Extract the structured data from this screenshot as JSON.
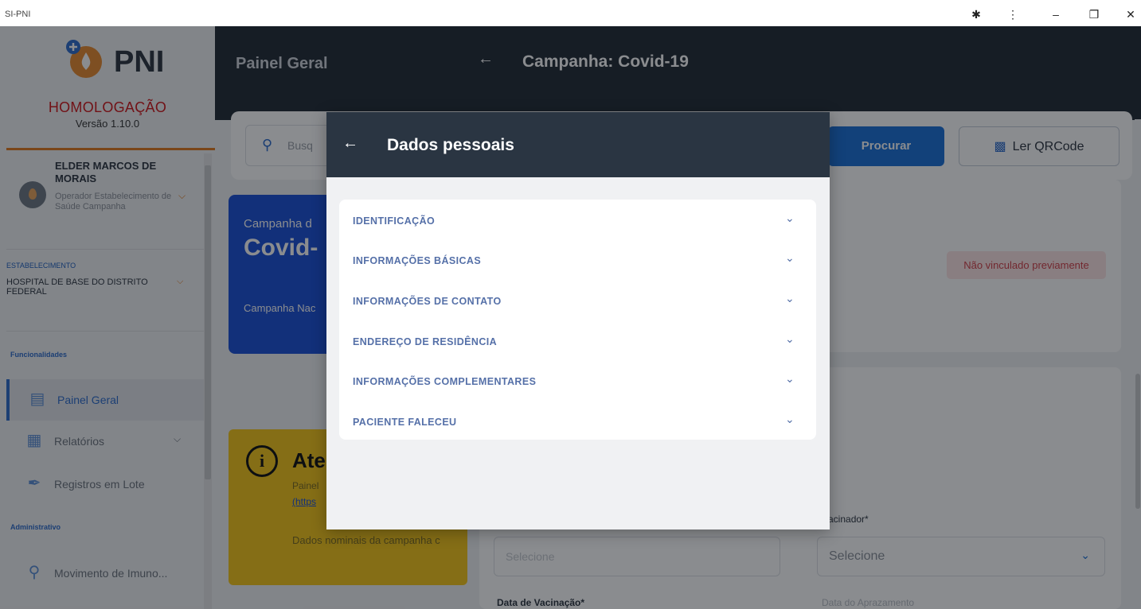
{
  "window": {
    "title": "SI-PNI",
    "buttons": [
      "extensions-icon",
      "menu-icon",
      "minimize-icon",
      "restore-icon",
      "close-icon"
    ]
  },
  "sidebar": {
    "logo_text": "PNI",
    "environment": "HOMOLOGAÇÃO",
    "version": "Versão 1.10.0",
    "user": {
      "name": "ELDER MARCOS DE MORAIS",
      "role": "Operador Estabelecimento de Saúde Campanha"
    },
    "estabelecimento": {
      "title": "ESTABELECIMENTO",
      "value": "HOSPITAL DE BASE DO DISTRITO FEDERAL"
    },
    "sections": [
      {
        "title": "Funcionalidades"
      },
      {
        "title": "Administrativo"
      }
    ],
    "items": [
      {
        "label": "Painel Geral",
        "icon": "monitor-icon"
      },
      {
        "label": "Relatórios",
        "icon": "report-icon"
      },
      {
        "label": "Registros em Lote",
        "icon": "syringe-icon"
      },
      {
        "label": "Movimento de Imuno...",
        "icon": "vial-icon"
      }
    ]
  },
  "header": {
    "panel_title": "Painel Geral",
    "campaign_title": "Campanha: Covid-19"
  },
  "search": {
    "placeholder": "Busq",
    "procurar_label": "Procurar",
    "qr_label": "Ler QRCode"
  },
  "campaign_card": {
    "line1": "Campanha d",
    "line2": "Covid-",
    "line3": "Campanha Nac"
  },
  "badge": "Não vinculado previamente",
  "atencao": {
    "title": "Ate",
    "line1": "Painel",
    "line2": "(https",
    "line3": "Dados nominais da campanha c"
  },
  "form": {
    "vacinador_label": "acinador*",
    "select_left_placeholder": "Selecione",
    "select_right_placeholder": "Selecione",
    "date_label": "Data de Vacinação*",
    "aprazamento_label": "Data do Aprazamento"
  },
  "modal": {
    "title": "Dados pessoais",
    "sections": [
      {
        "label": "IDENTIFICAÇÃO"
      },
      {
        "label": "INFORMAÇÕES BÁSICAS"
      },
      {
        "label": "INFORMAÇÕES DE CONTATO"
      },
      {
        "label": "ENDEREÇO DE RESIDÊNCIA"
      },
      {
        "label": "INFORMAÇÕES COMPLEMENTARES"
      },
      {
        "label": "PACIENTE FALECEU"
      }
    ]
  },
  "colors": {
    "header_bg": "#222b35",
    "primary": "#1a6fd6",
    "campaign_card": "#1a4fd6",
    "warning": "#f5c518",
    "env_red": "#d0161a",
    "accent_orange": "#e07a1e"
  }
}
